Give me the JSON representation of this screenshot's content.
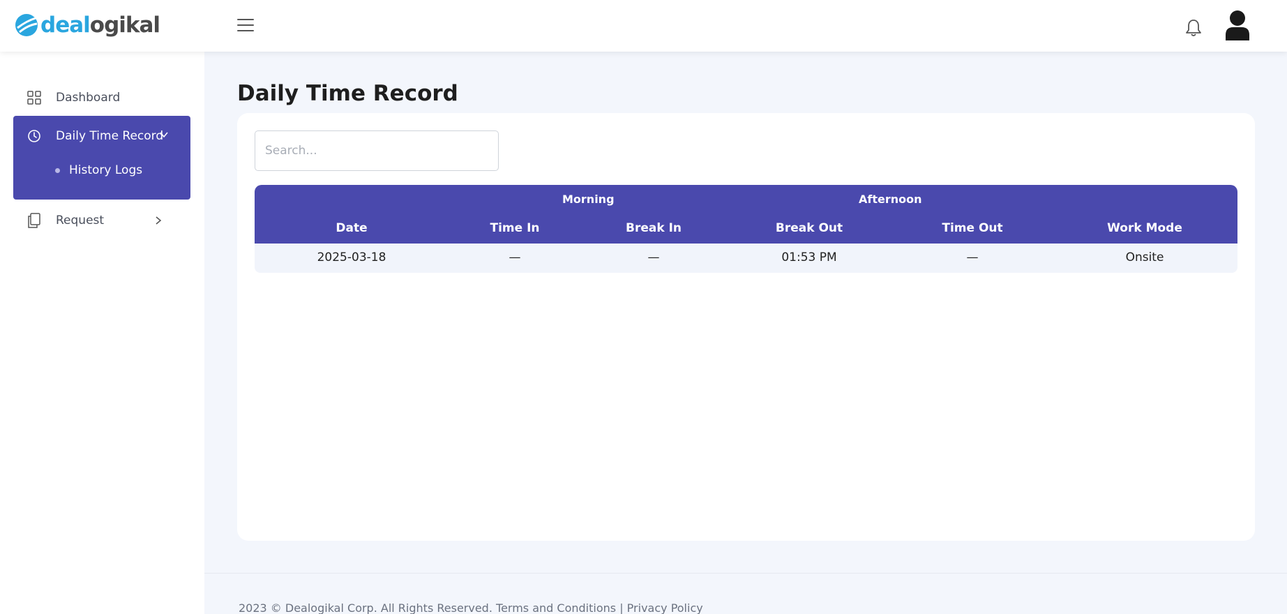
{
  "app": {
    "logo_part1": "deal",
    "logo_part2": "ogikal"
  },
  "icons": {
    "menu": "hamburger-icon",
    "notifications": "bell-icon",
    "user": "user-avatar-icon",
    "dashboard": "grid-icon",
    "dtr": "clock-icon",
    "request": "document-copy-icon"
  },
  "colors": {
    "accent": "#4a49ad",
    "brand_blue": "#2aa6df",
    "background": "#f3f6fc"
  },
  "sidebar": {
    "items": [
      {
        "label": "Dashboard"
      },
      {
        "label": "Daily Time Record",
        "sub_items": [
          {
            "label": "History Logs"
          }
        ]
      },
      {
        "label": "Request"
      }
    ]
  },
  "main": {
    "title": "Daily Time Record",
    "search": {
      "placeholder": "Search...",
      "value": ""
    },
    "table": {
      "groups": [
        "Morning",
        "Afternoon"
      ],
      "columns": [
        "Date",
        "Time In",
        "Break In",
        "Break Out",
        "Time Out",
        "Work Mode"
      ],
      "rows": [
        [
          "2025-03-18",
          "—",
          "—",
          "01:53 PM",
          "—",
          "Onsite"
        ]
      ]
    }
  },
  "footer": {
    "copyright": "2023 © Dealogikal Corp. All Rights Reserved.",
    "terms": "Terms and Conditions",
    "separator": "|",
    "privacy": "Privacy Policy"
  }
}
